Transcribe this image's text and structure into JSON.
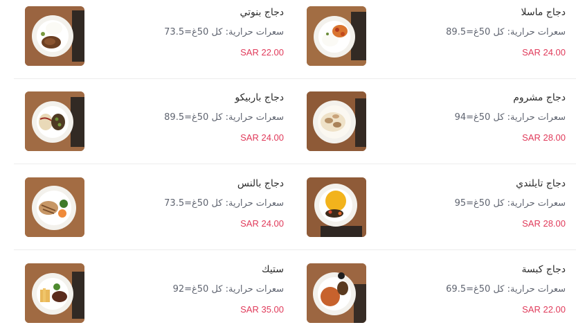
{
  "items": [
    {
      "name": "دجاج ماسلا",
      "calories": "سعرات حرارية: كل 50غ=89.5",
      "price": "SAR 24.00",
      "image": "masala-dish"
    },
    {
      "name": "دجاج بنوتي",
      "calories": "سعرات حرارية: كل 50غ=73.5",
      "price": "SAR 22.00",
      "image": "bnoti-dish"
    },
    {
      "name": "دجاج مشروم",
      "calories": "سعرات حرارية: كل 50غ=94",
      "price": "SAR 28.00",
      "image": "mushroom-dish"
    },
    {
      "name": "دجاج باربيكو",
      "calories": "سعرات حرارية: كل 50غ=89.5",
      "price": "SAR 24.00",
      "image": "bbq-dish"
    },
    {
      "name": "دجاج تايلندي",
      "calories": "سعرات حرارية: كل 50غ=95",
      "price": "SAR 28.00",
      "image": "thai-dish"
    },
    {
      "name": "دجاج بالنس",
      "calories": "سعرات حرارية: كل 50غ=73.5",
      "price": "SAR 24.00",
      "image": "balance-dish"
    },
    {
      "name": "دجاج كبسة",
      "calories": "سعرات حرارية: كل 50غ=69.5",
      "price": "SAR 22.00",
      "image": "kabsa-dish"
    },
    {
      "name": "ستيك",
      "calories": "سعرات حرارية: كل 50غ=92",
      "price": "SAR 35.00",
      "image": "steak-dish"
    }
  ],
  "colors": {
    "price": "#e03a5a",
    "name": "#2b2b2b",
    "calories": "#5f6470",
    "divider": "#ececec"
  }
}
